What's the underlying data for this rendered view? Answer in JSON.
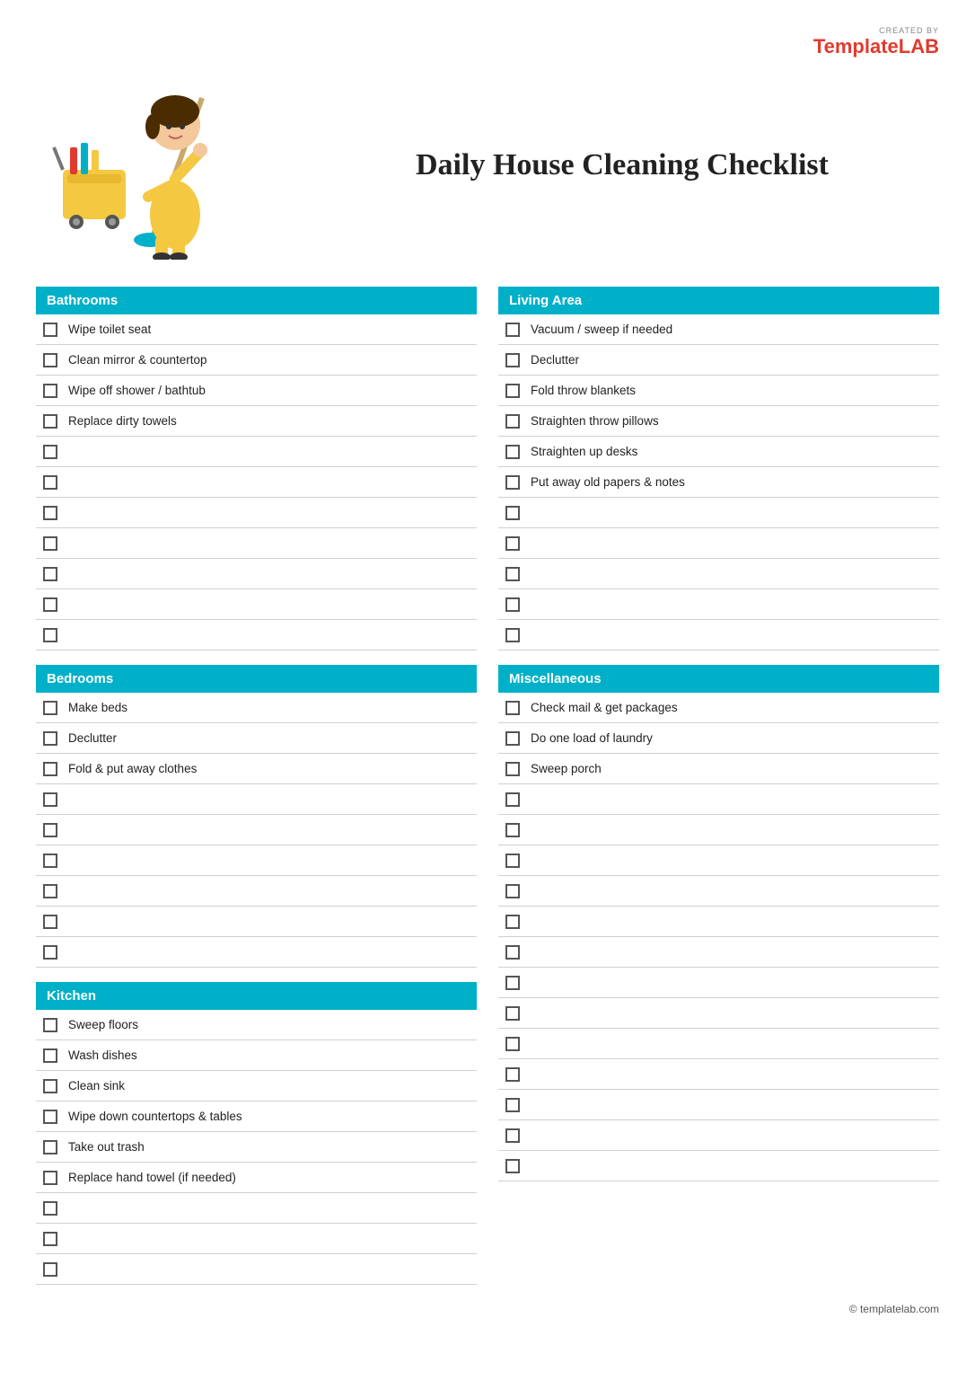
{
  "logo": {
    "created_by": "CREATED BY",
    "brand_part1": "Template",
    "brand_part2": "LAB"
  },
  "title": "Daily House Cleaning Checklist",
  "sections": {
    "bathrooms": {
      "label": "Bathrooms",
      "items": [
        "Wipe toilet seat",
        "Clean mirror & countertop",
        "Wipe off shower / bathtub",
        "Replace dirty towels",
        "",
        "",
        "",
        "",
        "",
        "",
        ""
      ]
    },
    "bedrooms": {
      "label": "Bedrooms",
      "items": [
        "Make beds",
        "Declutter",
        "Fold & put away clothes",
        "",
        "",
        "",
        "",
        "",
        ""
      ]
    },
    "kitchen": {
      "label": "Kitchen",
      "items": [
        "Sweep floors",
        "Wash dishes",
        "Clean sink",
        "Wipe down countertops & tables",
        "Take out trash",
        "Replace hand towel (if needed)",
        "",
        "",
        ""
      ]
    },
    "living_area": {
      "label": "Living Area",
      "items": [
        "Vacuum / sweep if needed",
        "Declutter",
        "Fold throw blankets",
        "Straighten throw pillows",
        "Straighten up desks",
        "Put away old papers & notes",
        "",
        "",
        "",
        "",
        ""
      ]
    },
    "miscellaneous": {
      "label": "Miscellaneous",
      "items": [
        "Check mail & get packages",
        "Do one load of laundry",
        "Sweep porch",
        "",
        "",
        "",
        "",
        "",
        "",
        "",
        "",
        "",
        "",
        "",
        "",
        ""
      ]
    }
  },
  "footer": {
    "text": "© templatelab.com"
  }
}
